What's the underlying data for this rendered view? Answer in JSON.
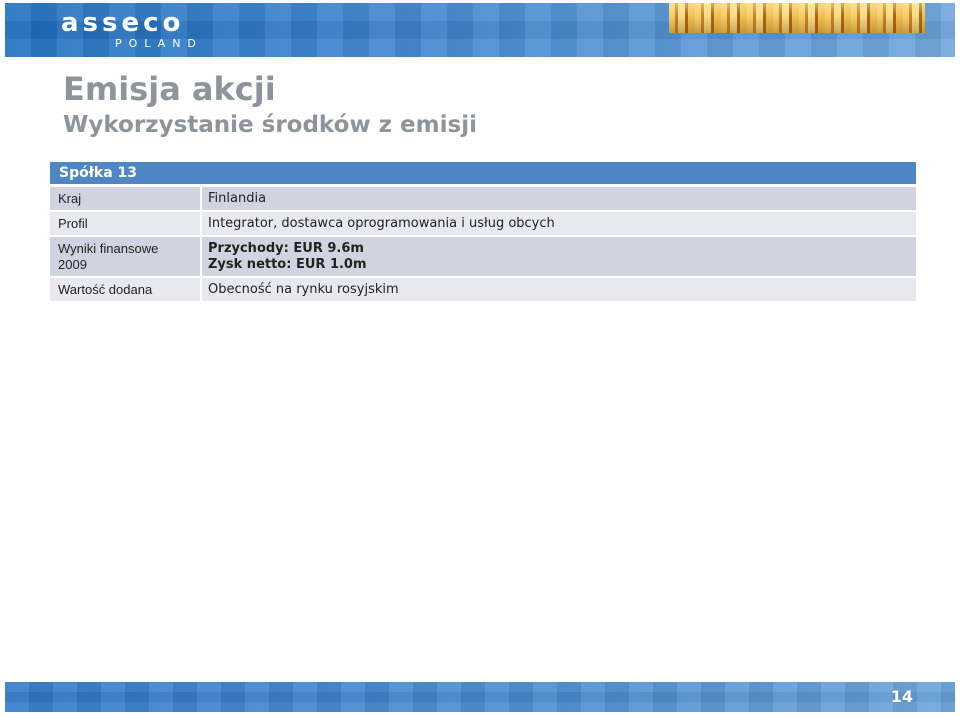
{
  "header": {
    "logo_word": "asseco",
    "logo_sub": "POLAND"
  },
  "title": "Emisja akcji",
  "subtitle": "Wykorzystanie środków z emisji",
  "table": {
    "heading": "Spółka 13",
    "rows": [
      {
        "label": "Kraj",
        "value": "Finlandia"
      },
      {
        "label": "Profil",
        "value": "Integrator, dostawca oprogramowania i usług obcych"
      },
      {
        "label_lines": [
          "Wyniki finansowe",
          "2009"
        ],
        "value_lines": [
          "Przychody: EUR 9.6m",
          "Zysk netto: EUR 1.0m"
        ]
      },
      {
        "label": "Wartość dodana",
        "value": "Obecność na rynku rosyjskim"
      }
    ]
  },
  "footer": {
    "page_number": "14"
  },
  "colors": {
    "brand_blue": "#4f86c4",
    "title_gray": "#8d949c",
    "row_dark": "#d0d4e1",
    "row_light": "#e8e9f0"
  }
}
